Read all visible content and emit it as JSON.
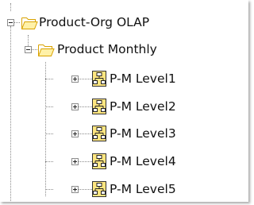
{
  "tree": {
    "root": {
      "label": "Product-Org OLAP",
      "icon": "open-folder-icon",
      "expanded": true
    },
    "child": {
      "label": "Product Monthly",
      "icon": "open-folder-icon",
      "expanded": true
    },
    "levels": [
      {
        "label": "P-M Level1",
        "icon": "level-hierarchy-icon",
        "expanded": false
      },
      {
        "label": "P-M Level2",
        "icon": "level-hierarchy-icon",
        "expanded": false
      },
      {
        "label": "P-M Level3",
        "icon": "level-hierarchy-icon",
        "expanded": false
      },
      {
        "label": "P-M Level4",
        "icon": "level-hierarchy-icon",
        "expanded": false
      },
      {
        "label": "P-M Level5",
        "icon": "level-hierarchy-icon",
        "expanded": false
      }
    ]
  },
  "colors": {
    "folder_fill": "#fff1a8",
    "folder_stroke": "#d9a200",
    "level_icon_fill": "#ffe680",
    "level_icon_stroke": "#333333",
    "text": "#111111"
  }
}
